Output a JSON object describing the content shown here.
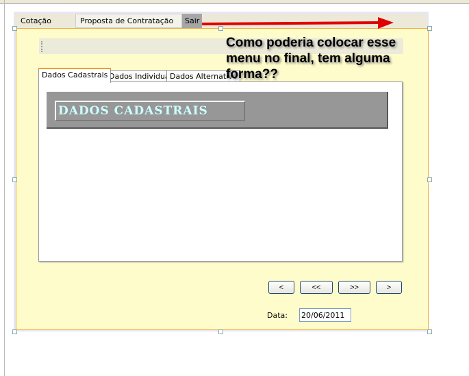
{
  "menu": {
    "items": [
      "Cotação",
      "Proposta de Contratação",
      "Sair"
    ]
  },
  "tabs": [
    "Dados Cadastrais",
    "Dados Individual",
    "Dados Alternativo"
  ],
  "header_title": "DADOS CADASTRAIS",
  "nav_buttons": [
    "<",
    "<<",
    ">>",
    ">"
  ],
  "date": {
    "label": "Data:",
    "value": "20/06/2011"
  },
  "annotation": "Como poderia colocar esse menu no final, tem alguma forma??",
  "colors": {
    "panel": "#fffccc",
    "arrow": "#e00000",
    "header": "#979797"
  }
}
